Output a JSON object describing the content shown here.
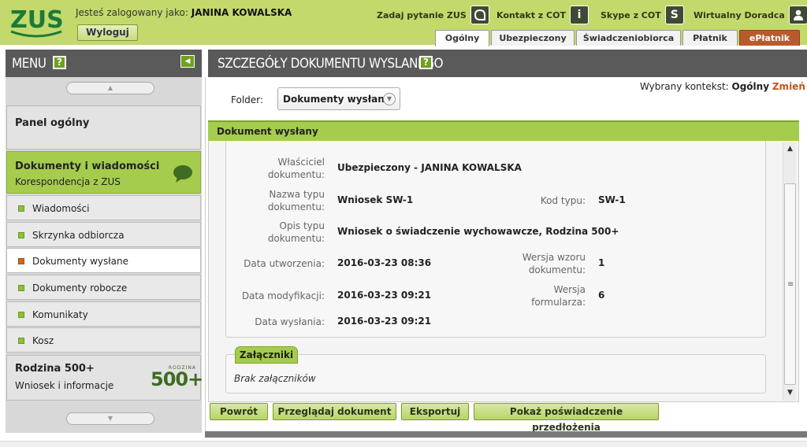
{
  "header": {
    "logo": "ZUS",
    "logged_prefix": "Jesteś zalogowany jako:",
    "user_name": "JANINA KOWALSKA",
    "logout_label": "Wyloguj",
    "links": [
      {
        "label": "Zadaj pytanie ZUS",
        "icon": "chat-icon"
      },
      {
        "label": "Kontakt z COT",
        "icon": "info-icon"
      },
      {
        "label": "Skype z COT",
        "icon": "skype-icon"
      },
      {
        "label": "Wirtualny Doradca",
        "icon": "person-icon"
      }
    ],
    "tabs": [
      "Ogólny",
      "Ubezpieczony",
      "Świadczeniobiorca",
      "Płatnik",
      "ePłatnik"
    ],
    "active_tab": "Ogólny"
  },
  "sidebar": {
    "title": "MENU",
    "help": "?",
    "panels": {
      "panel_ogolny": "Panel ogólny",
      "dokumenty_title": "Dokumenty i wiadomości",
      "dokumenty_sub": "Korespondencja z ZUS",
      "rodzina_title": "Rodzina 500+",
      "rodzina_sub": "Wniosek i informacje",
      "rodzina_logo_top": "RODZINA",
      "rodzina_logo_num": "500+"
    },
    "items": [
      "Wiadomości",
      "Skrzynka odbiorcza",
      "Dokumenty wysłane",
      "Dokumenty robocze",
      "Komunikaty",
      "Kosz"
    ],
    "active_item": "Dokumenty wysłane"
  },
  "main": {
    "title": "SZCZEGÓŁY DOKUMENTU WYSLANEGO",
    "help": "?",
    "folder_label": "Folder:",
    "folder_value": "Dokumenty wysłane",
    "context_label": "Wybrany kontekst:",
    "context_value": "Ogólny",
    "context_change": "Zmień",
    "doc_section": "Dokument wysłany",
    "fields": {
      "owner_k1": "Właściciel",
      "owner_k2": "dokumentu:",
      "owner_v": "Ubezpieczony - JANINA KOWALSKA",
      "type_k1": "Nazwa typu",
      "type_k2": "dokumentu:",
      "type_v": "Wniosek SW-1",
      "code_k": "Kod typu:",
      "code_v": "SW-1",
      "desc_k1": "Opis typu",
      "desc_k2": "dokumentu:",
      "desc_v": "Wniosek o świadczenie wychowawcze, Rodzina 500+",
      "created_k": "Data utworzenia:",
      "created_v": "2016-03-23 08:36",
      "tplver_k1": "Wersja wzoru",
      "tplver_k2": "dokumentu:",
      "tplver_v": "1",
      "modified_k": "Data modyfikacji:",
      "modified_v": "2016-03-23 09:21",
      "formver_k1": "Wersja",
      "formver_k2": "formularza:",
      "formver_v": "6",
      "sent_k": "Data wysłania:",
      "sent_v": "2016-03-23 09:21"
    },
    "attachments_label": "Załączniki",
    "attachments_empty": "Brak załączników",
    "buttons": [
      "Powrót",
      "Przeglądaj dokument",
      "Eksportuj",
      "Pokaż poświadczenie przedłożenia"
    ]
  },
  "colors": {
    "header_green": "#c3d96b",
    "accent_green": "#a6cc4e",
    "eplatnik": "#b95a2d",
    "dark_bar": "#5a5a5a"
  }
}
